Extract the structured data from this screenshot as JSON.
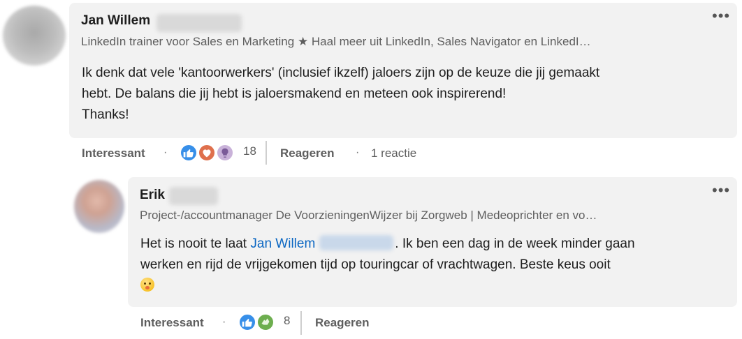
{
  "comment": {
    "author_first": "Jan Willem",
    "headline": "LinkedIn trainer voor Sales en Marketing ★ Haal meer uit LinkedIn, Sales Navigator en LinkedI…",
    "text_line1": "Ik denk dat vele 'kantoorwerkers' (inclusief ikzelf) jaloers zijn op de keuze die jij gemaakt",
    "text_line2": "hebt. De balans die jij hebt is jaloersmakend en meteen ook inspirerend!",
    "text_line3": "Thanks!",
    "more_label": "•••",
    "reaction_label": "Interessant",
    "separator": "·",
    "reaction_count": "18",
    "reply_label": "Reageren",
    "replies_label": "1 reactie",
    "reactions": [
      "like-icon",
      "love-icon",
      "insightful-icon"
    ]
  },
  "reply": {
    "author_first": "Erik",
    "headline": "Project-/accountmanager De VoorzieningenWijzer bij Zorgweb | Medeoprichter en vo…",
    "text_pre": "Het is nooit te laat ",
    "mention": "Jan Willem",
    "text_post": ". Ik ben een dag in de week minder gaan",
    "text_line2": "werken en rijd de vrijgekomen tijd op touringcar of vrachtwagen. Beste keus ooit",
    "emoji": "shushing-face-emoji",
    "more_label": "•••",
    "reaction_label": "Interessant",
    "separator": "·",
    "reaction_count": "8",
    "reply_label": "Reageren",
    "reactions": [
      "like-icon",
      "support-icon"
    ]
  },
  "colors": {
    "bubble": "#f2f2f2",
    "link": "#0a66c2",
    "muted": "#5e5e5e",
    "like": "#378fe9",
    "love": "#df704d",
    "support": "#6dae4f"
  }
}
